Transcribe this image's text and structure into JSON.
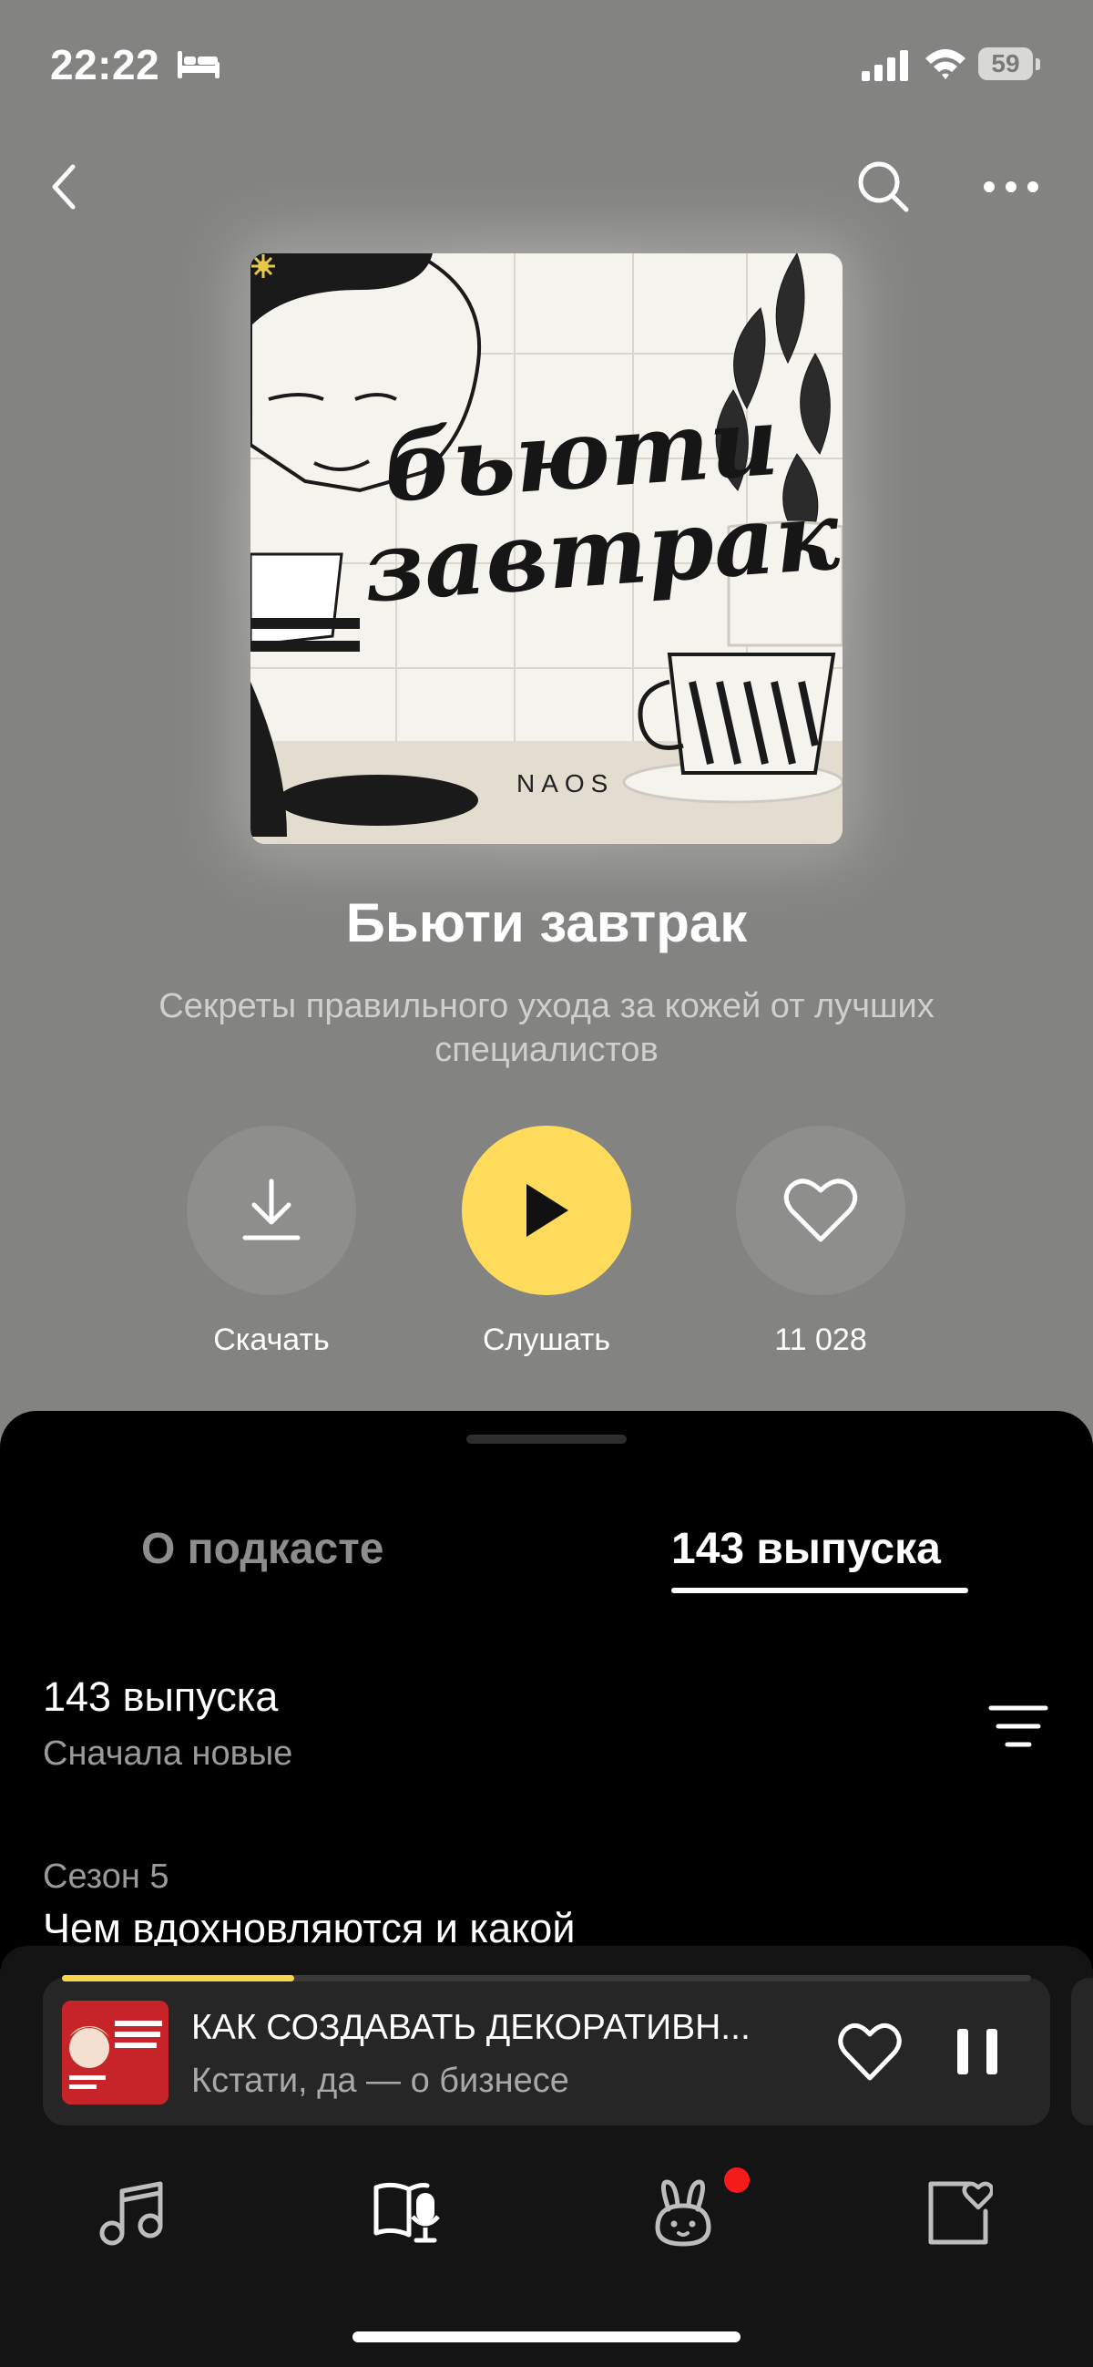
{
  "status_bar": {
    "time": "22:22",
    "battery": "59"
  },
  "podcast": {
    "cover_title_line1": "бьюти",
    "cover_title_line2": "завтрак",
    "cover_brand": "NAOS",
    "title": "Бьюти завтрак",
    "description": "Секреты правильного ухода за кожей от лучших специалистов"
  },
  "actions": {
    "download_label": "Скачать",
    "listen_label": "Слушать",
    "likes_count": "11 028"
  },
  "tabs": [
    {
      "label": "О подкасте",
      "active": false
    },
    {
      "label": "143 выпуска",
      "active": true
    }
  ],
  "episodes": {
    "count": "143 выпуска",
    "sort": "Сначала новые",
    "season": "Сезон 5",
    "first_title": "Чем вдохновляются и какой"
  },
  "mini_player": {
    "title": "КАК СОЗДАВАТЬ ДЕКОРАТИВН...",
    "subtitle": "Кстати, да — о бизнесе",
    "progress": 0.24
  },
  "nav": [
    {
      "icon": "music-note-icon"
    },
    {
      "icon": "podcasts-book-icon"
    },
    {
      "icon": "kids-bunny-icon"
    },
    {
      "icon": "collection-heart-icon"
    }
  ],
  "colors": {
    "accent_yellow": "#fedb5a",
    "header_bg": "#838381",
    "sheet_bg": "#000000",
    "notification": "#f51b1b"
  }
}
